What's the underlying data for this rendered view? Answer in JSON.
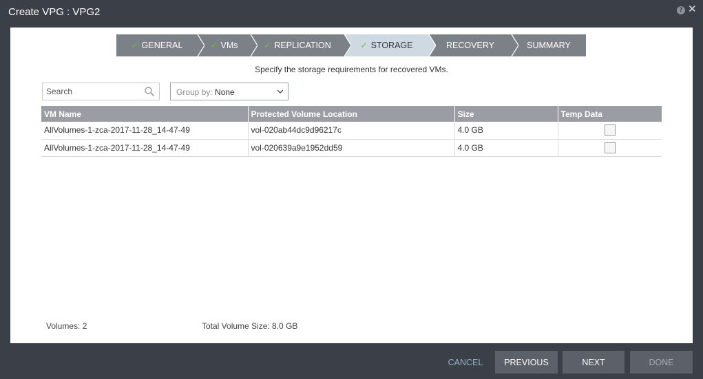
{
  "window": {
    "title": "Create VPG : VPG2",
    "help_glyph": "?",
    "close_glyph": "✕"
  },
  "wizard": {
    "steps": [
      {
        "label": "GENERAL",
        "done": true
      },
      {
        "label": "VMs",
        "done": true
      },
      {
        "label": "REPLICATION",
        "done": true
      },
      {
        "label": "STORAGE",
        "done": true,
        "active": true
      },
      {
        "label": "RECOVERY",
        "done": false
      },
      {
        "label": "SUMMARY",
        "done": false
      }
    ],
    "check_glyph": "✓",
    "subtitle": "Specify the storage requirements for recovered VMs."
  },
  "toolbar": {
    "search_placeholder": "Search",
    "groupby_label": "Group by: ",
    "groupby_value": "None"
  },
  "table": {
    "columns": [
      "VM Name",
      "Protected Volume Location",
      "Size",
      "Temp Data"
    ],
    "rows": [
      {
        "vm_name": "AllVolumes-1-zca-2017-11-28_14-47-49",
        "location": "vol-020ab44dc9d96217c",
        "size": "4.0 GB",
        "temp_data": false
      },
      {
        "vm_name": "AllVolumes-1-zca-2017-11-28_14-47-49",
        "location": "vol-020639a9e1952dd59",
        "size": "4.0 GB",
        "temp_data": false
      }
    ]
  },
  "footer": {
    "volumes": "Volumes: 2",
    "total_size": "Total Volume Size: 8.0 GB"
  },
  "buttons": {
    "cancel": "CANCEL",
    "previous": "PREVIOUS",
    "next": "NEXT",
    "done": "DONE"
  },
  "colors": {
    "background": "#3b3f48",
    "step_bg": "#7c8087",
    "step_active_bg": "#cfd9e2",
    "check": "#71c23f",
    "header_bg": "#9a9ea4",
    "cancel_link": "#8fb7c8"
  }
}
